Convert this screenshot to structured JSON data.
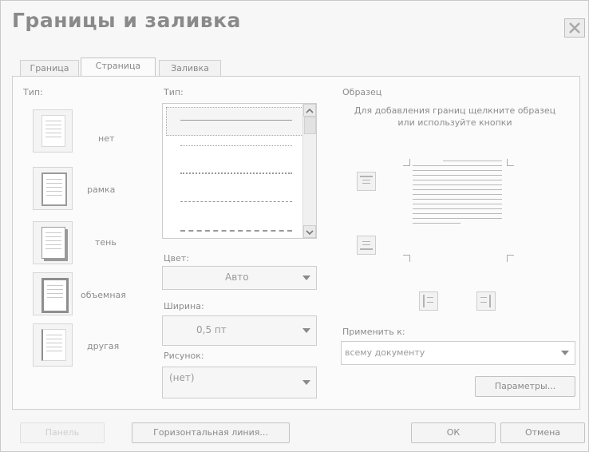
{
  "dialog": {
    "title": "Границы и заливка",
    "close_icon": "close-icon"
  },
  "tabs": [
    {
      "label": "Граница"
    },
    {
      "label": "Страница",
      "active": true
    },
    {
      "label": "Заливка"
    }
  ],
  "setting": {
    "label": "Тип:",
    "options": [
      {
        "label": "нет",
        "icon": "setting-none-icon"
      },
      {
        "label": "рамка",
        "icon": "setting-box-icon"
      },
      {
        "label": "тень",
        "icon": "setting-shadow-icon"
      },
      {
        "label": "объемная",
        "icon": "setting-3d-icon"
      },
      {
        "label": "другая",
        "icon": "setting-custom-icon"
      }
    ]
  },
  "style": {
    "label": "Тип:",
    "line_styles": [
      "solid",
      "dotted",
      "dash-dot-dot",
      "dashed",
      "dash-dot"
    ]
  },
  "color": {
    "label": "Цвет:",
    "value": "Авто"
  },
  "width": {
    "label": "Ширина:",
    "value": "0,5 пт"
  },
  "art": {
    "label": "Рисунок:",
    "value": "(нет)"
  },
  "preview": {
    "label": "Образец",
    "hint": "Для добавления границ щелкните образец или используйте кнопки"
  },
  "apply_to": {
    "label": "Применить к:",
    "value": "всему документу"
  },
  "buttons": {
    "options": "Параметры...",
    "show_toolbar": "Панель",
    "horizontal_line": "Горизонтальная линия...",
    "ok": "ОК",
    "cancel": "Отмена"
  }
}
